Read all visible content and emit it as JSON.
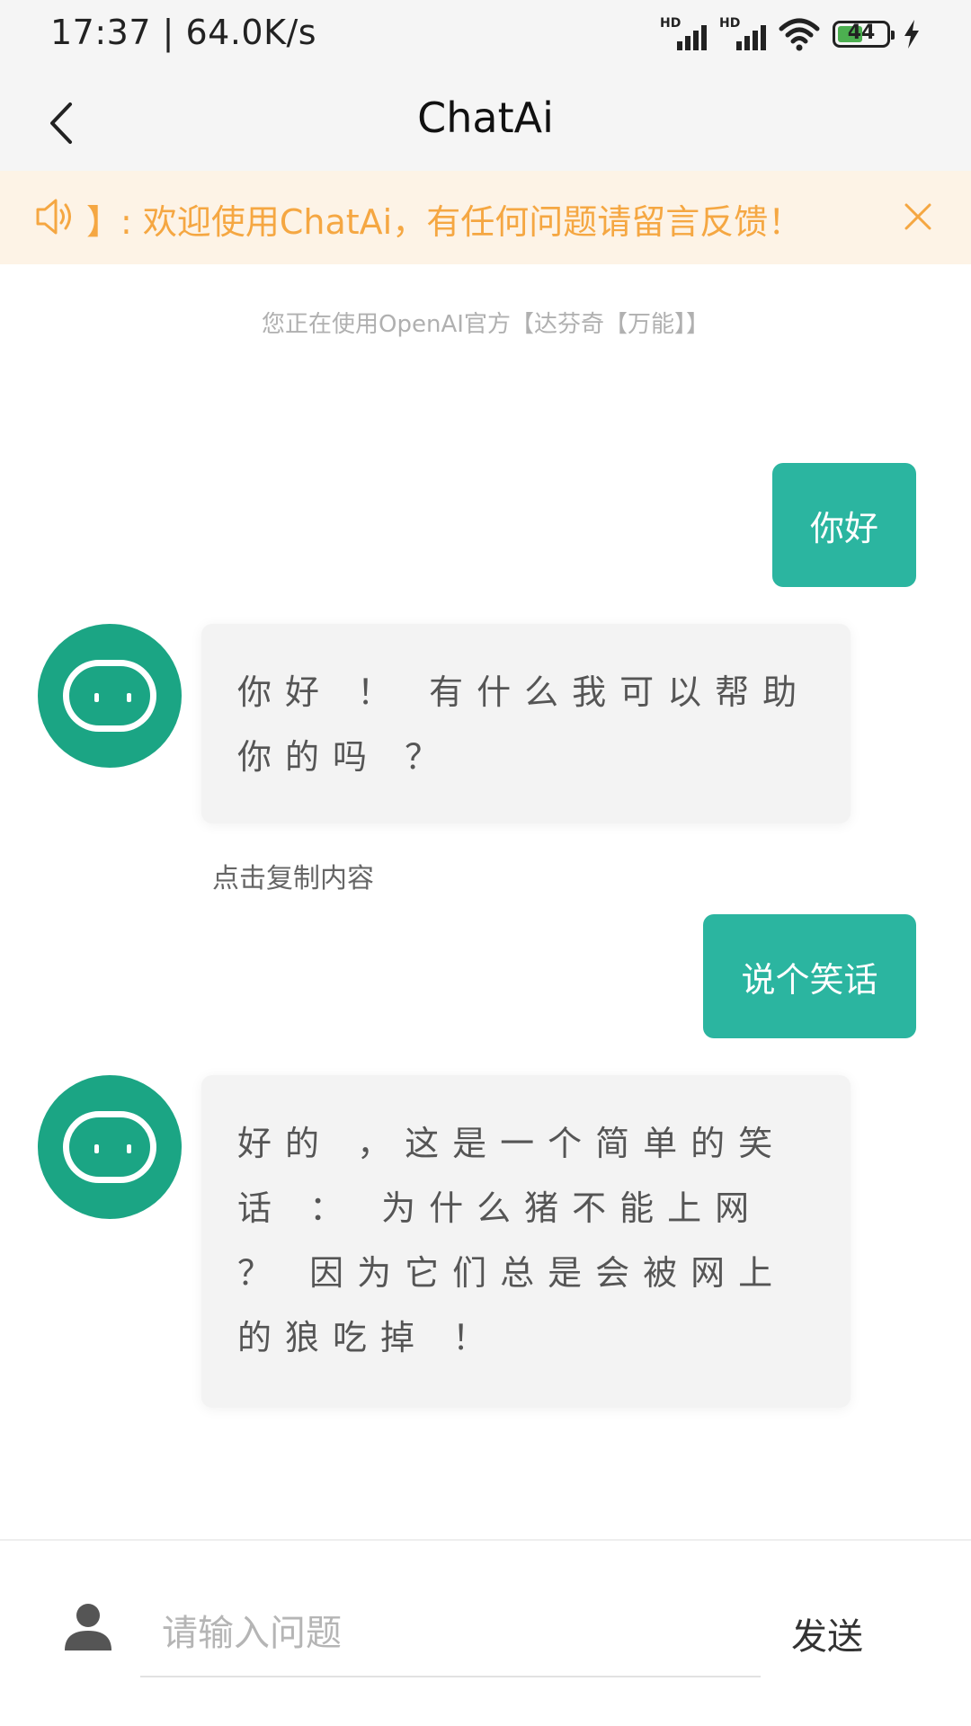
{
  "status_bar": {
    "time_speed": "17:37 | 64.0K/s",
    "sim1_label": "HD",
    "sim2_label": "HD",
    "battery_level": "44",
    "icons": [
      "signal-icon",
      "signal-icon",
      "wifi-icon",
      "battery-icon",
      "charging-icon"
    ]
  },
  "header": {
    "title": "ChatAi",
    "back_icon": "chevron-left-icon"
  },
  "notice": {
    "text": "】: 欢迎使用ChatAi，有任何问题请留言反馈！",
    "icon": "speaker-icon",
    "close_icon": "close-icon",
    "color": "#f5a742",
    "background": "#fdf3e6"
  },
  "model_info": "您正在使用OpenAI官方【达芬奇【万能】】",
  "messages": [
    {
      "role": "user",
      "text": "你好"
    },
    {
      "role": "assistant",
      "text": "你好 ！ 有什么我可以帮助你的吗 ？"
    },
    {
      "role": "user",
      "text": "说个笑话"
    },
    {
      "role": "assistant",
      "text": "好的 ，这是一个简单的笑话 ： 为什么猪不能上网 ？ 因为它们总是会被网上的狼吃掉 ！"
    }
  ],
  "copy_hint": "点击复制内容",
  "input": {
    "placeholder": "请输入问题",
    "value": "",
    "send_label": "发送",
    "user_icon": "person-icon"
  },
  "colors": {
    "accent": "#2bb5a0",
    "avatar": "#1ba584"
  }
}
